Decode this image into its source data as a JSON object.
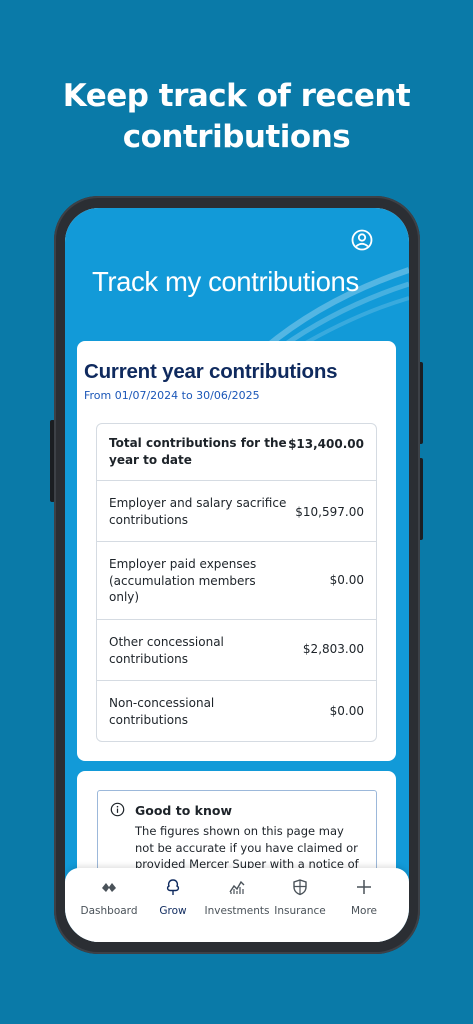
{
  "headline": {
    "line1": "Keep track of recent",
    "line2": "contributions"
  },
  "hero": {
    "title": "Track my contributions"
  },
  "contributions": {
    "title": "Current year contributions",
    "period": "From 01/07/2024 to 30/06/2025",
    "rows": [
      {
        "label": "Total contributions for the year to date",
        "value": "$13,400.00"
      },
      {
        "label": "Employer and salary sacrifice contributions",
        "value": "$10,597.00"
      },
      {
        "label": "Employer paid expenses (accumulation members only)",
        "value": "$0.00"
      },
      {
        "label": "Other concessional contributions",
        "value": "$2,803.00"
      },
      {
        "label": "Non-concessional contributions",
        "value": "$0.00"
      }
    ]
  },
  "notice": {
    "icon": "info-icon",
    "title": "Good to know",
    "body": "The figures shown on this page may not be accurate if you have claimed or provided Mercer Super with a notice of"
  },
  "nav": {
    "items": [
      {
        "label": "Dashboard",
        "icon": "dashboard-icon"
      },
      {
        "label": "Grow",
        "icon": "tree-icon",
        "active": true
      },
      {
        "label": "Investments",
        "icon": "investments-chart-icon"
      },
      {
        "label": "Insurance",
        "icon": "shield-icon"
      },
      {
        "label": "More",
        "icon": "plus-icon"
      }
    ]
  },
  "colors": {
    "page_background": "#0a7aa8",
    "hero_background": "#129ad8",
    "title_navy": "#0f2a5e",
    "period_blue": "#1b57b8"
  }
}
